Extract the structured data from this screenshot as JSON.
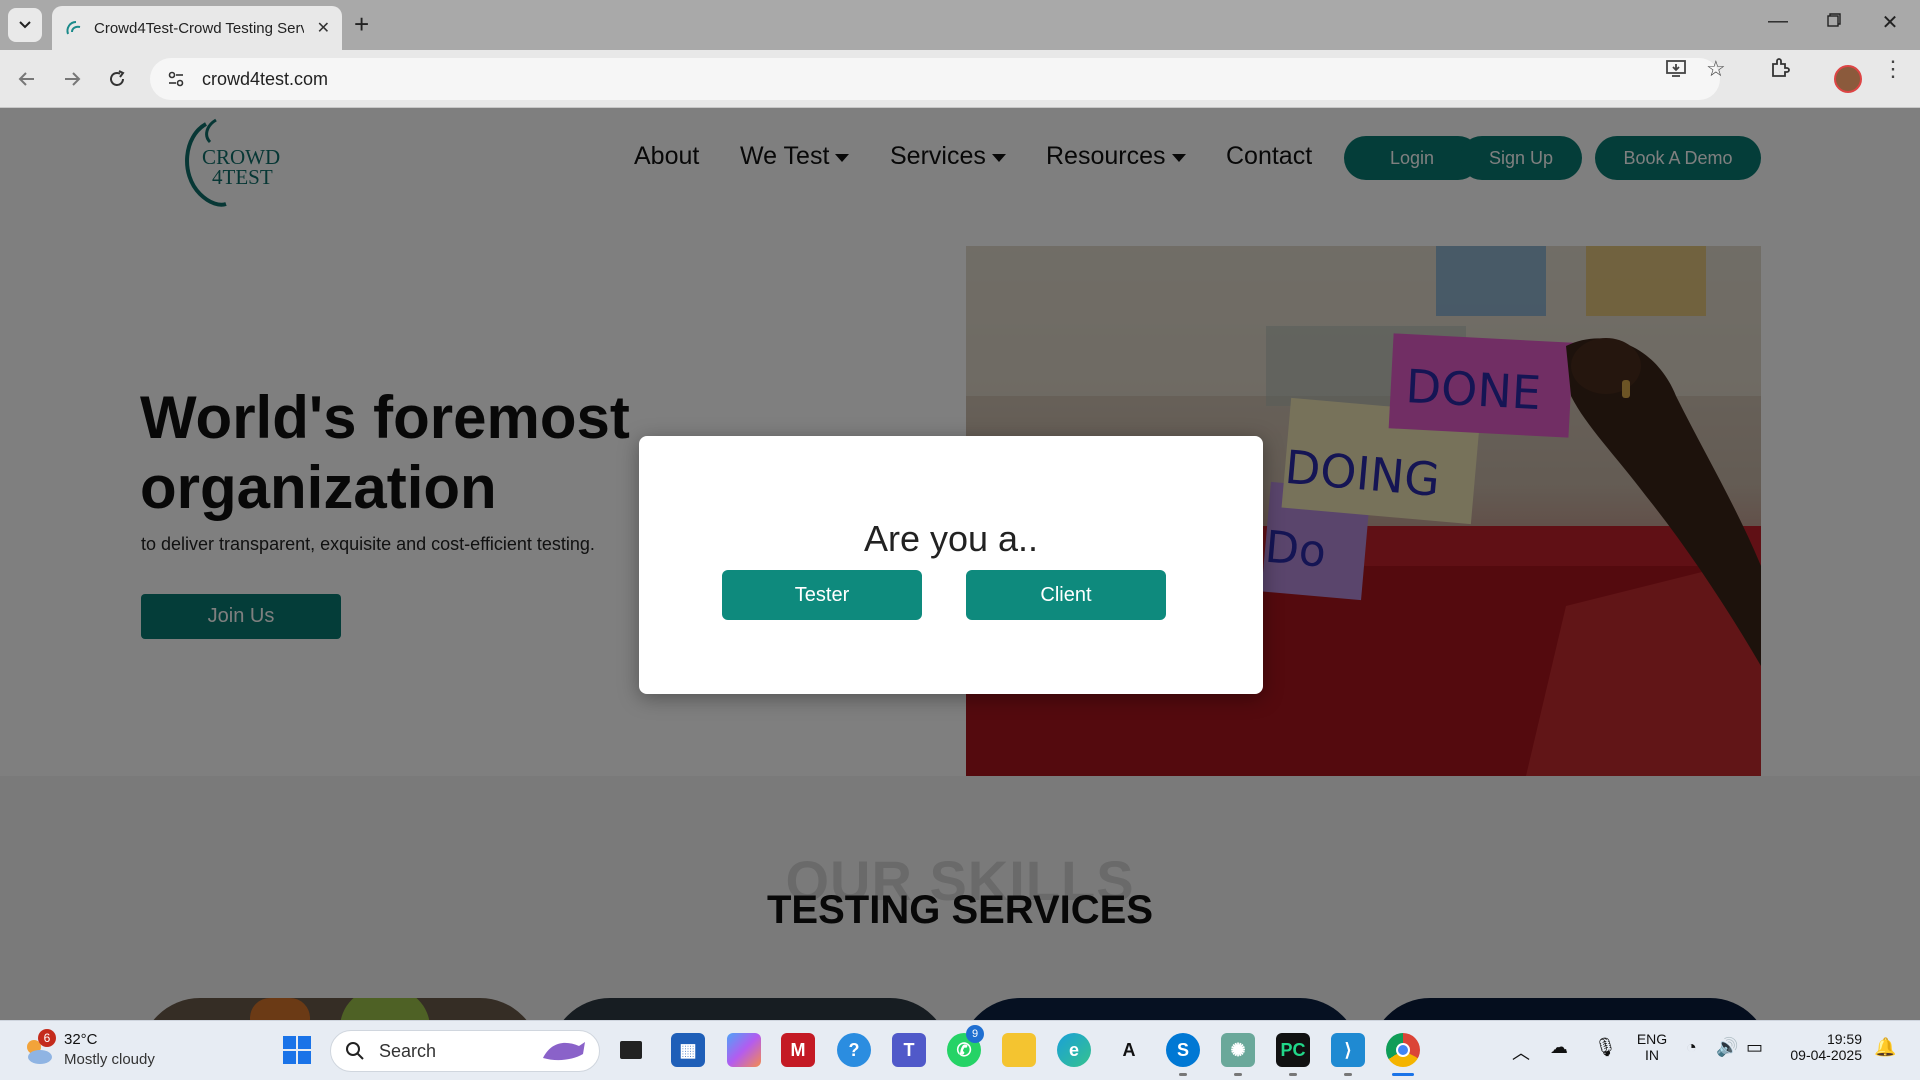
{
  "browser": {
    "tab_title": "Crowd4Test-Crowd Testing Serv",
    "url": "crowd4test.com"
  },
  "site": {
    "logo_text": [
      "CROWD",
      "4TEST"
    ],
    "nav": [
      {
        "label": "About"
      },
      {
        "label": "We Test",
        "dropdown": true
      },
      {
        "label": "Services",
        "dropdown": true
      },
      {
        "label": "Resources",
        "dropdown": true
      },
      {
        "label": "Contact"
      }
    ],
    "buttons": {
      "login": "Login",
      "signup": "Sign Up",
      "demo": "Book A Demo"
    },
    "brand_color": "#087b72"
  },
  "hero": {
    "title_line1": "World's foremost",
    "title_line2": "organization",
    "subtitle": "to deliver transparent, exquisite and cost-efficient testing.",
    "cta": "Join Us",
    "image_notes": [
      "DONE",
      "DOING",
      "Do"
    ]
  },
  "skills": {
    "ghost_heading": "OUR SKILLS",
    "heading": "TESTING SERVICES"
  },
  "modal": {
    "title": "Are you a..",
    "option_tester": "Tester",
    "option_client": "Client"
  },
  "taskbar": {
    "weather_temp": "32°C",
    "weather_condition": "Mostly cloudy",
    "weather_badge": "6",
    "search_label": "Search",
    "whatsapp_badge": "9",
    "language_line1": "ENG",
    "language_line2": "IN",
    "time": "19:59",
    "date": "09-04-2025"
  }
}
